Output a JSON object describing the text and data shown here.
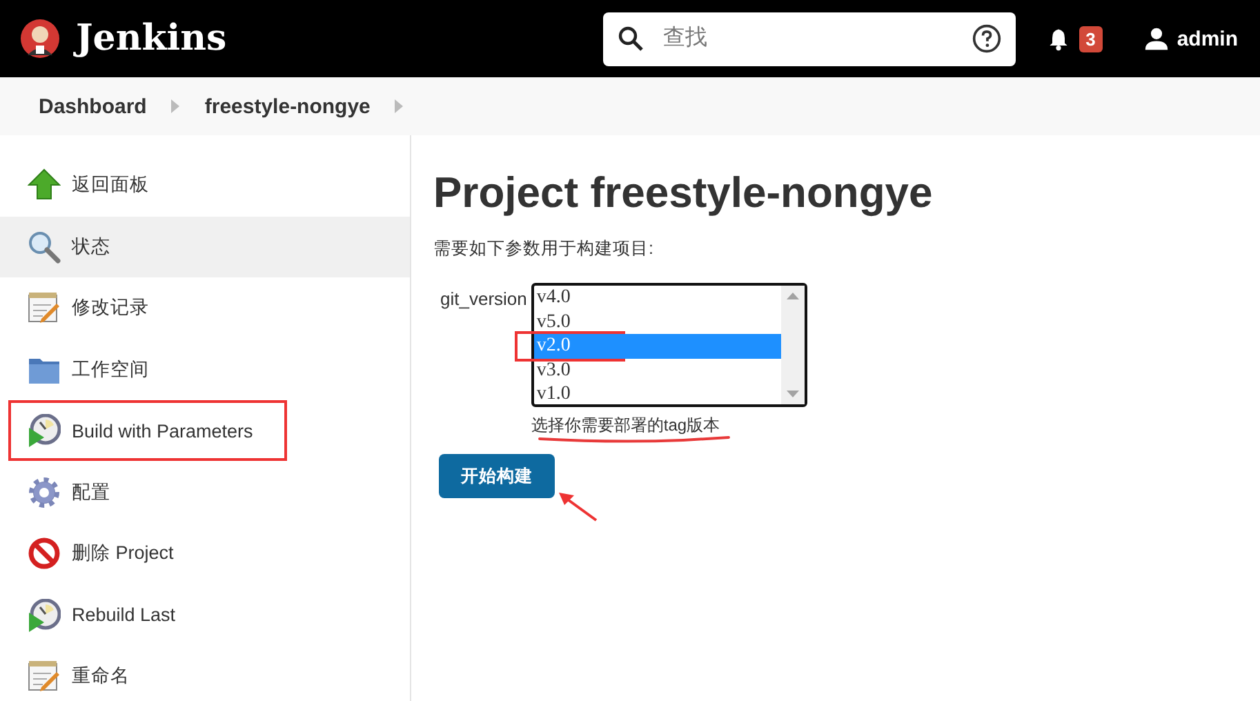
{
  "header": {
    "brand": "Jenkins",
    "search": {
      "placeholder": "查找"
    },
    "notifications": "3",
    "user": "admin"
  },
  "breadcrumbs": [
    "Dashboard",
    "freestyle-nongye"
  ],
  "sidebar": {
    "items": [
      {
        "label": "返回面板",
        "selected": false,
        "marked": false
      },
      {
        "label": "状态",
        "selected": true,
        "marked": false
      },
      {
        "label": "修改记录",
        "selected": false,
        "marked": false
      },
      {
        "label": "工作空间",
        "selected": false,
        "marked": false
      },
      {
        "label": "Build with Parameters",
        "selected": false,
        "marked": true
      },
      {
        "label": "配置",
        "selected": false,
        "marked": false
      },
      {
        "label": "删除 Project",
        "selected": false,
        "marked": false
      },
      {
        "label": "Rebuild Last",
        "selected": false,
        "marked": false
      },
      {
        "label": "重命名",
        "selected": false,
        "marked": false
      }
    ]
  },
  "main": {
    "title": "Project freestyle-nongye",
    "intro": "需要如下参数用于构建项目:",
    "parameter": {
      "name": "git_version",
      "options": [
        {
          "label": "v4.0",
          "selected": false,
          "marked": false
        },
        {
          "label": "v5.0",
          "selected": false,
          "marked": false
        },
        {
          "label": "v2.0",
          "selected": true,
          "marked": true
        },
        {
          "label": "v3.0",
          "selected": false,
          "marked": false
        },
        {
          "label": "v1.0",
          "selected": false,
          "marked": false
        }
      ],
      "hint": "选择你需要部署的tag版本",
      "hint_underlined": true
    },
    "build_button": "开始构建",
    "button_arrow": true
  }
}
